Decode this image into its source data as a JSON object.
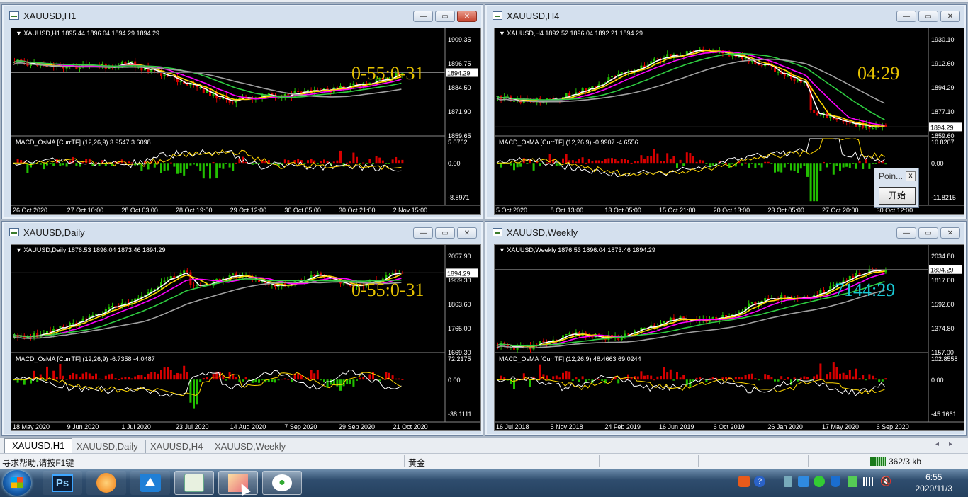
{
  "colors": {
    "bull": "#22c000",
    "bear": "#d80000",
    "ma_white": "#ffffff",
    "ma_yellow": "#ffd700",
    "ma_magenta": "#ff00ff",
    "ma_green": "#2ecc40",
    "ma_gray": "#a0a0a0",
    "timer_yellow": "#e6c200",
    "timer_cyan": "#19c8d4"
  },
  "windows": [
    {
      "title": "XAUUSD,H1",
      "info": "XAUUSD,H1  1895.44 1896.04 1894.29 1894.29",
      "macd_info": "MACD_OsMA [CurrTF] (12,26,9) 3.9547 3.6098",
      "price_ticks": [
        "1909.35",
        "1896.75",
        "1884.50",
        "1871.90",
        "1859.65"
      ],
      "price_current": "1894.29",
      "macd_ticks": [
        "5.0762",
        "0.00",
        "-8.8971"
      ],
      "time_ticks": [
        "26 Oct 2020",
        "27 Oct 10:00",
        "28 Oct 03:00",
        "28 Oct 19:00",
        "29 Oct 12:00",
        "30 Oct 05:00",
        "30 Oct 21:00",
        "2 Nov 15:00"
      ],
      "timer": "0-55:0-31",
      "timer_color": "yellow"
    },
    {
      "title": "XAUUSD,H4",
      "info": "XAUUSD,H4  1892.52 1896.04 1892.21 1894.29",
      "macd_info": "MACD_OsMA [CurrTF] (12,26,9) -0.9907 -4.6556",
      "price_ticks": [
        "1930.10",
        "1912.60",
        "1894.29",
        "1877.10",
        "1859.60"
      ],
      "price_current": "1894.29",
      "macd_ticks": [
        "10.8207",
        "0.00",
        "-11.8215"
      ],
      "time_ticks": [
        "5 Oct 2020",
        "8 Oct 13:00",
        "13 Oct 05:00",
        "15 Oct 21:00",
        "20 Oct 13:00",
        "23 Oct 05:00",
        "27 Oct 20:00",
        "30 Oct 12:00"
      ],
      "timer": "04:29",
      "timer_color": "yellow"
    },
    {
      "title": "XAUUSD,Daily",
      "info": "XAUUSD,Daily  1876.53 1896.04 1873.46 1894.29",
      "macd_info": "MACD_OsMA [CurrTF] (12,26,9) -6.7358 -4.0487",
      "price_ticks": [
        "2057.90",
        "1959.30",
        "1863.60",
        "1765.00",
        "1669.30"
      ],
      "price_current": "1894.29",
      "macd_ticks": [
        "72.2175",
        "0.00",
        "-38.1111"
      ],
      "time_ticks": [
        "18 May 2020",
        "9 Jun 2020",
        "1 Jul 2020",
        "23 Jul 2020",
        "14 Aug 2020",
        "7 Sep 2020",
        "29 Sep 2020",
        "21 Oct 2020"
      ],
      "timer": "0-55:0-31",
      "timer_color": "yellow"
    },
    {
      "title": "XAUUSD,Weekly",
      "info": "XAUUSD,Weekly  1876.53 1896.04 1873.46 1894.29",
      "macd_info": "MACD_OsMA [CurrTF] (12,26,9) 48.4663 69.0244",
      "price_ticks": [
        "2034.80",
        "1817.00",
        "1592.60",
        "1374.80",
        "1157.00"
      ],
      "price_current": "1894.29",
      "macd_ticks": [
        "102.8558",
        "0.00",
        "-45.1661"
      ],
      "time_ticks": [
        "16 Jul 2018",
        "5 Nov 2018",
        "24 Feb 2019",
        "16 Jun 2019",
        "6 Oct 2019",
        "26 Jan 2020",
        "17 May 2020",
        "6 Sep 2020"
      ],
      "timer": "7144:29",
      "timer_color": "cyan"
    }
  ],
  "popup": {
    "title": "Poin...",
    "close": "x",
    "button": "开始"
  },
  "tabs": [
    "XAUUSD,H1",
    "XAUUSD,Daily",
    "XAUUSD,H4",
    "XAUUSD,Weekly"
  ],
  "status": {
    "help": "寻求帮助,请按F1键",
    "symbol": "黄金",
    "traffic": "362/3 kb"
  },
  "taskbar": {
    "ps": "Ps",
    "time": "6:55",
    "date": "2020/11/3"
  },
  "window_buttons": {
    "min": "—",
    "max": "▭",
    "close": "✕"
  }
}
